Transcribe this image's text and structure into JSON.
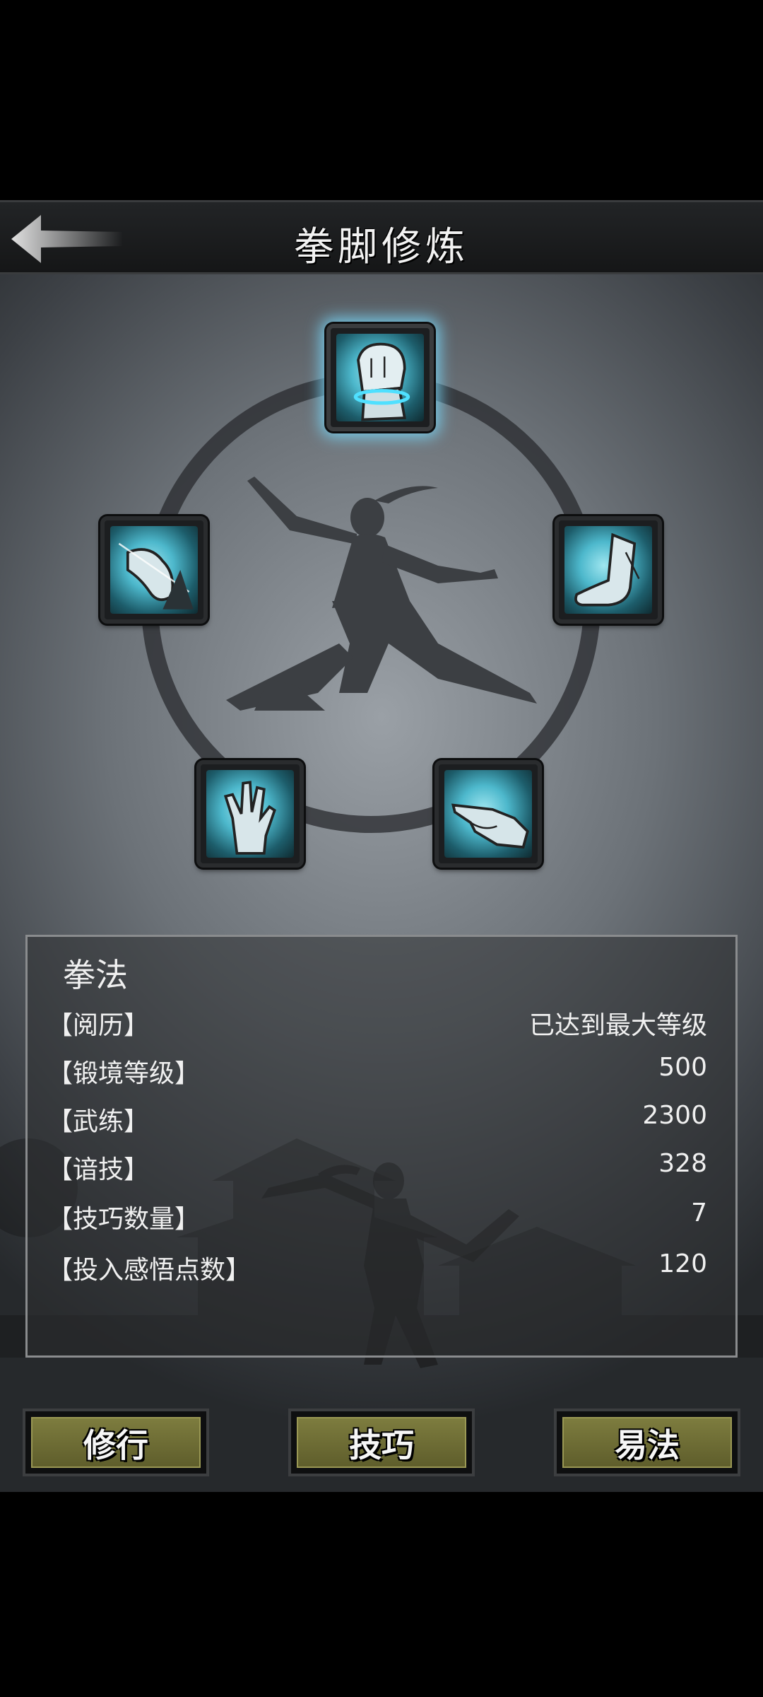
{
  "header": {
    "title": "拳脚修炼",
    "back_icon": "back-arrow-icon"
  },
  "skills": [
    {
      "id": "fist",
      "icon": "fist-icon",
      "active": true
    },
    {
      "id": "claw",
      "icon": "claw-icon",
      "active": false
    },
    {
      "id": "kick",
      "icon": "foot-icon",
      "active": false
    },
    {
      "id": "palm",
      "icon": "palm-icon",
      "active": false
    },
    {
      "id": "finger",
      "icon": "finger-icon",
      "active": false
    }
  ],
  "panel": {
    "name": "拳法",
    "stats": [
      {
        "label": "【阅历】",
        "value": "已达到最大等级"
      },
      {
        "label": "【锻境等级】",
        "value": "500"
      },
      {
        "label": "【武练】",
        "value": "2300"
      },
      {
        "label": "【谙技】",
        "value": "328"
      },
      {
        "label": "【技巧数量】",
        "value": "7"
      },
      {
        "label": "【投入感悟点数】",
        "value": "120"
      }
    ]
  },
  "buttons": {
    "practice": "修行",
    "skill": "技巧",
    "change": "易法"
  },
  "colors": {
    "accent_glow": "#78dcff",
    "button_face": "#7e7d3f",
    "panel_border": "#8a8c8e"
  }
}
